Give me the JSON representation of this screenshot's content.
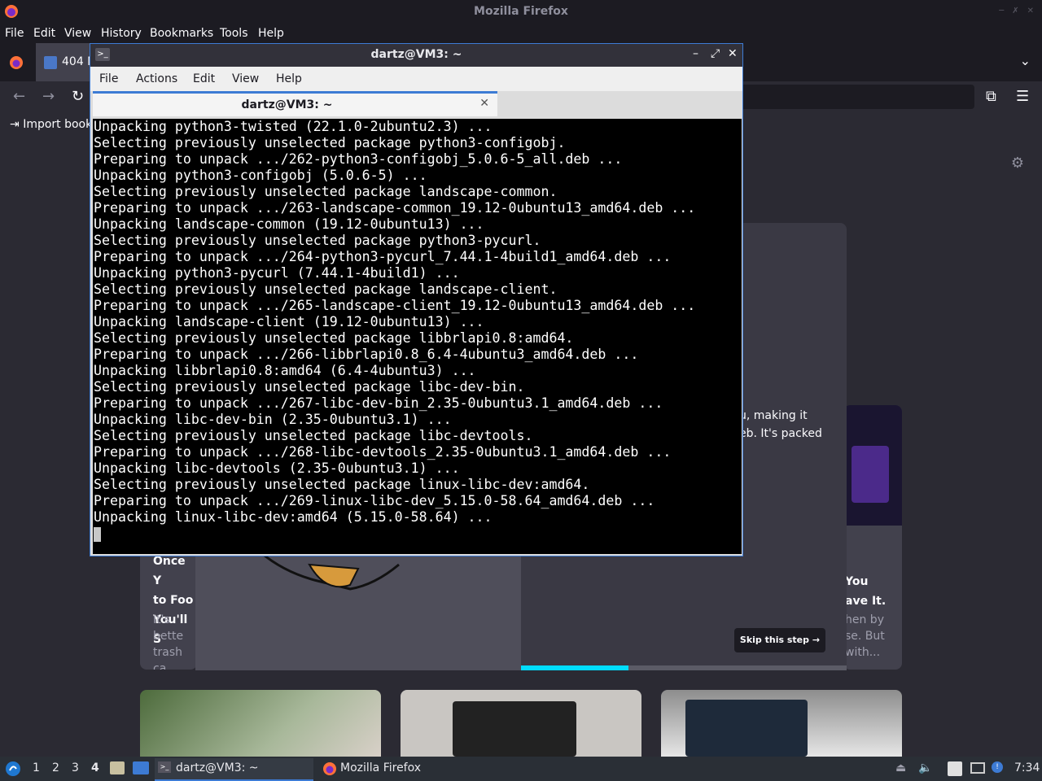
{
  "firefox": {
    "window_title": "Mozilla Firefox",
    "menu": [
      "File",
      "Edit",
      "View",
      "History",
      "Bookmarks",
      "Tools",
      "Help"
    ],
    "tab_title": "404 N",
    "bookmark_label": "Import book",
    "content": {
      "left_card_title": [
        "Once Y",
        "to Foo",
        "You'll S"
      ],
      "left_card_body": [
        "It's bette",
        "trash ca"
      ],
      "right_card_title": [
        "You",
        "ave It."
      ],
      "right_card_body": [
        "hen by",
        "se. But",
        "with..."
      ],
      "middle_snippet": [
        "u, making it",
        "eb. It's packed"
      ],
      "skip_button": "Skip this step →",
      "progress_fraction": 0.33
    }
  },
  "terminal": {
    "window_title": "dartz@VM3: ~",
    "menu": [
      "File",
      "Actions",
      "Edit",
      "View",
      "Help"
    ],
    "tab_label": "dartz@VM3: ~",
    "lines": [
      "Unpacking python3-twisted (22.1.0-2ubuntu2.3) ...",
      "Selecting previously unselected package python3-configobj.",
      "Preparing to unpack .../262-python3-configobj_5.0.6-5_all.deb ...",
      "Unpacking python3-configobj (5.0.6-5) ...",
      "Selecting previously unselected package landscape-common.",
      "Preparing to unpack .../263-landscape-common_19.12-0ubuntu13_amd64.deb ...",
      "Unpacking landscape-common (19.12-0ubuntu13) ...",
      "Selecting previously unselected package python3-pycurl.",
      "Preparing to unpack .../264-python3-pycurl_7.44.1-4build1_amd64.deb ...",
      "Unpacking python3-pycurl (7.44.1-4build1) ...",
      "Selecting previously unselected package landscape-client.",
      "Preparing to unpack .../265-landscape-client_19.12-0ubuntu13_amd64.deb ...",
      "Unpacking landscape-client (19.12-0ubuntu13) ...",
      "Selecting previously unselected package libbrlapi0.8:amd64.",
      "Preparing to unpack .../266-libbrlapi0.8_6.4-4ubuntu3_amd64.deb ...",
      "Unpacking libbrlapi0.8:amd64 (6.4-4ubuntu3) ...",
      "Selecting previously unselected package libc-dev-bin.",
      "Preparing to unpack .../267-libc-dev-bin_2.35-0ubuntu3.1_amd64.deb ...",
      "Unpacking libc-dev-bin (2.35-0ubuntu3.1) ...",
      "Selecting previously unselected package libc-devtools.",
      "Preparing to unpack .../268-libc-devtools_2.35-0ubuntu3.1_amd64.deb ...",
      "Unpacking libc-devtools (2.35-0ubuntu3.1) ...",
      "Selecting previously unselected package linux-libc-dev:amd64.",
      "Preparing to unpack .../269-linux-libc-dev_5.15.0-58.64_amd64.deb ...",
      "Unpacking linux-libc-dev:amd64 (5.15.0-58.64) ..."
    ]
  },
  "taskbar": {
    "workspaces": [
      "1",
      "2",
      "3",
      "4"
    ],
    "active_workspace": "4",
    "tasks": [
      "dartz@VM3: ~",
      "Mozilla Firefox"
    ],
    "clock": "7:34"
  }
}
